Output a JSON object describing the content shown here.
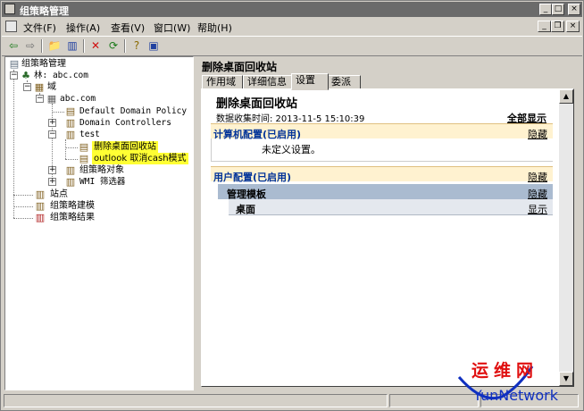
{
  "window": {
    "title": "组策略管理"
  },
  "menu": {
    "items": [
      "文件(F)",
      "操作(A)",
      "查看(V)",
      "窗口(W)",
      "帮助(H)"
    ]
  },
  "tree": {
    "root": "组策略管理",
    "forest": "林: abc.com",
    "domains": "域",
    "domain": "abc.com",
    "default_policy": "Default Domain Policy",
    "domain_controllers": "Domain Controllers",
    "ou_test": "test",
    "gpo_recycle": "删除桌面回收站",
    "gpo_outlook": "outlook 取消cash模式",
    "gpo_objects": "组策略对象",
    "wmi_filters": "WMI 筛选器",
    "sites": "站点",
    "modeling": "组策略建模",
    "results": "组策略结果"
  },
  "right": {
    "title": "删除桌面回收站",
    "tabs": [
      "作用域",
      "详细信息",
      "设置",
      "委派"
    ],
    "active_tab": "设置",
    "report": {
      "title": "删除桌面回收站",
      "collected": "数据收集时间: 2013-11-5 15:10:39",
      "show_all": "全部显示",
      "computer_section": "计算机配置(已启用)",
      "computer_hide": "隐藏",
      "computer_body": "未定义设置。",
      "user_section": "用户配置(已启用)",
      "user_hide": "隐藏",
      "admin_templates": "管理模板",
      "admin_hide": "隐藏",
      "desktop": "桌面",
      "desktop_show": "显示"
    }
  },
  "watermark": {
    "cn": "运维网",
    "en": "YunNetwork"
  }
}
